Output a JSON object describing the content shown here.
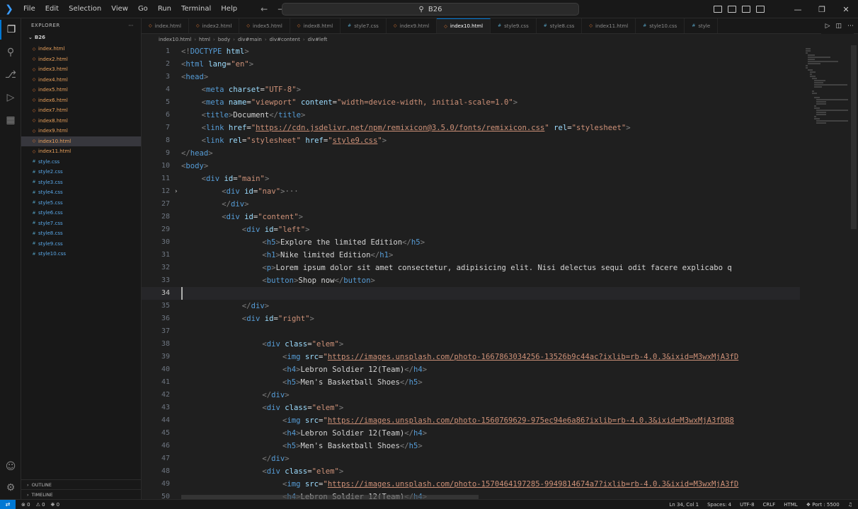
{
  "menu": [
    "File",
    "Edit",
    "Selection",
    "View",
    "Go",
    "Run",
    "Terminal",
    "Help"
  ],
  "command_center": "B26",
  "sidebar": {
    "header": "EXPLORER",
    "folder": "B26",
    "files": [
      {
        "name": "index.html",
        "type": "html"
      },
      {
        "name": "index2.html",
        "type": "html"
      },
      {
        "name": "index3.html",
        "type": "html"
      },
      {
        "name": "index4.html",
        "type": "html"
      },
      {
        "name": "index5.html",
        "type": "html"
      },
      {
        "name": "index6.html",
        "type": "html"
      },
      {
        "name": "index7.html",
        "type": "html"
      },
      {
        "name": "index8.html",
        "type": "html"
      },
      {
        "name": "index9.html",
        "type": "html"
      },
      {
        "name": "index10.html",
        "type": "html",
        "selected": true
      },
      {
        "name": "index11.html",
        "type": "html"
      },
      {
        "name": "style.css",
        "type": "css"
      },
      {
        "name": "style2.css",
        "type": "css"
      },
      {
        "name": "style3.css",
        "type": "css"
      },
      {
        "name": "style4.css",
        "type": "css"
      },
      {
        "name": "style5.css",
        "type": "css"
      },
      {
        "name": "style6.css",
        "type": "css"
      },
      {
        "name": "style7.css",
        "type": "css"
      },
      {
        "name": "style8.css",
        "type": "css"
      },
      {
        "name": "style9.css",
        "type": "css"
      },
      {
        "name": "style10.css",
        "type": "css"
      }
    ],
    "outline": "OUTLINE",
    "timeline": "TIMELINE"
  },
  "tabs": [
    {
      "label": "index.html",
      "type": "html"
    },
    {
      "label": "index2.html",
      "type": "html"
    },
    {
      "label": "index5.html",
      "type": "html"
    },
    {
      "label": "index8.html",
      "type": "html"
    },
    {
      "label": "style7.css",
      "type": "css"
    },
    {
      "label": "index9.html",
      "type": "html"
    },
    {
      "label": "index10.html",
      "type": "html",
      "active": true
    },
    {
      "label": "style9.css",
      "type": "css"
    },
    {
      "label": "style8.css",
      "type": "css"
    },
    {
      "label": "index11.html",
      "type": "html"
    },
    {
      "label": "style10.css",
      "type": "css"
    },
    {
      "label": "style",
      "type": "css"
    }
  ],
  "breadcrumb": [
    "index10.html",
    "html",
    "body",
    "div#main",
    "div#content",
    "div#left"
  ],
  "current_line": "34",
  "code_lines": [
    {
      "n": "1",
      "i": 0,
      "p": [
        [
          "t",
          "<!"
        ],
        [
          "tn",
          "DOCTYPE"
        ],
        [
          "an",
          " html"
        ],
        [
          "t",
          ">"
        ]
      ]
    },
    {
      "n": "2",
      "i": 0,
      "p": [
        [
          "t",
          "<"
        ],
        [
          "tn",
          "html"
        ],
        [
          "an",
          " lang"
        ],
        [
          "tx",
          "="
        ],
        [
          "av",
          "\"en\""
        ],
        [
          "t",
          ">"
        ]
      ]
    },
    {
      "n": "3",
      "i": 0,
      "p": [
        [
          "t",
          "<"
        ],
        [
          "tn",
          "head"
        ],
        [
          "t",
          ">"
        ]
      ]
    },
    {
      "n": "4",
      "i": 1,
      "p": [
        [
          "t",
          "<"
        ],
        [
          "tn",
          "meta"
        ],
        [
          "an",
          " charset"
        ],
        [
          "tx",
          "="
        ],
        [
          "av",
          "\"UTF-8\""
        ],
        [
          "t",
          ">"
        ]
      ]
    },
    {
      "n": "5",
      "i": 1,
      "p": [
        [
          "t",
          "<"
        ],
        [
          "tn",
          "meta"
        ],
        [
          "an",
          " name"
        ],
        [
          "tx",
          "="
        ],
        [
          "av",
          "\"viewport\""
        ],
        [
          "an",
          " content"
        ],
        [
          "tx",
          "="
        ],
        [
          "av",
          "\"width=device-width, initial-scale=1.0\""
        ],
        [
          "t",
          ">"
        ]
      ]
    },
    {
      "n": "6",
      "i": 1,
      "p": [
        [
          "t",
          "<"
        ],
        [
          "tn",
          "title"
        ],
        [
          "t",
          ">"
        ],
        [
          "tx",
          "Document"
        ],
        [
          "t",
          "</"
        ],
        [
          "tn",
          "title"
        ],
        [
          "t",
          ">"
        ]
      ]
    },
    {
      "n": "7",
      "i": 1,
      "p": [
        [
          "t",
          "<"
        ],
        [
          "tn",
          "link"
        ],
        [
          "an",
          " href"
        ],
        [
          "tx",
          "="
        ],
        [
          "av",
          "\""
        ],
        [
          "lk",
          "https://cdn.jsdelivr.net/npm/remixicon@3.5.0/fonts/remixicon.css"
        ],
        [
          "av",
          "\""
        ],
        [
          "an",
          " rel"
        ],
        [
          "tx",
          "="
        ],
        [
          "av",
          "\"stylesheet\""
        ],
        [
          "t",
          ">"
        ]
      ]
    },
    {
      "n": "8",
      "i": 1,
      "p": [
        [
          "t",
          "<"
        ],
        [
          "tn",
          "link"
        ],
        [
          "an",
          " rel"
        ],
        [
          "tx",
          "="
        ],
        [
          "av",
          "\"stylesheet\""
        ],
        [
          "an",
          " href"
        ],
        [
          "tx",
          "="
        ],
        [
          "av",
          "\""
        ],
        [
          "lk",
          "style9.css"
        ],
        [
          "av",
          "\""
        ],
        [
          "t",
          ">"
        ]
      ]
    },
    {
      "n": "9",
      "i": 0,
      "p": [
        [
          "t",
          "</"
        ],
        [
          "tn",
          "head"
        ],
        [
          "t",
          ">"
        ]
      ]
    },
    {
      "n": "10",
      "i": 0,
      "p": [
        [
          "t",
          "<"
        ],
        [
          "tn",
          "body"
        ],
        [
          "t",
          ">"
        ]
      ]
    },
    {
      "n": "11",
      "i": 1,
      "p": [
        [
          "t",
          "<"
        ],
        [
          "tn",
          "div"
        ],
        [
          "an",
          " id"
        ],
        [
          "tx",
          "="
        ],
        [
          "av",
          "\"main\""
        ],
        [
          "t",
          ">"
        ]
      ]
    },
    {
      "n": "12",
      "i": 2,
      "fold": true,
      "p": [
        [
          "t",
          "<"
        ],
        [
          "tn",
          "div"
        ],
        [
          "an",
          " id"
        ],
        [
          "tx",
          "="
        ],
        [
          "av",
          "\"nav\""
        ],
        [
          "t",
          ">"
        ],
        [
          "el",
          "···"
        ]
      ]
    },
    {
      "n": "27",
      "i": 2,
      "p": [
        [
          "t",
          "</"
        ],
        [
          "tn",
          "div"
        ],
        [
          "t",
          ">"
        ]
      ]
    },
    {
      "n": "28",
      "i": 2,
      "p": [
        [
          "t",
          "<"
        ],
        [
          "tn",
          "div"
        ],
        [
          "an",
          " id"
        ],
        [
          "tx",
          "="
        ],
        [
          "av",
          "\"content\""
        ],
        [
          "t",
          ">"
        ]
      ]
    },
    {
      "n": "29",
      "i": 3,
      "p": [
        [
          "t",
          "<"
        ],
        [
          "tn",
          "div"
        ],
        [
          "an",
          " id"
        ],
        [
          "tx",
          "="
        ],
        [
          "av",
          "\"left\""
        ],
        [
          "t",
          ">"
        ]
      ]
    },
    {
      "n": "30",
      "i": 4,
      "p": [
        [
          "t",
          "<"
        ],
        [
          "tn",
          "h5"
        ],
        [
          "t",
          ">"
        ],
        [
          "tx",
          "Explore the limited Edition"
        ],
        [
          "t",
          "</"
        ],
        [
          "tn",
          "h5"
        ],
        [
          "t",
          ">"
        ]
      ]
    },
    {
      "n": "31",
      "i": 4,
      "p": [
        [
          "t",
          "<"
        ],
        [
          "tn",
          "h1"
        ],
        [
          "t",
          ">"
        ],
        [
          "tx",
          "Nike limited Edition"
        ],
        [
          "t",
          "</"
        ],
        [
          "tn",
          "h1"
        ],
        [
          "t",
          ">"
        ]
      ]
    },
    {
      "n": "32",
      "i": 4,
      "p": [
        [
          "t",
          "<"
        ],
        [
          "tn",
          "p"
        ],
        [
          "t",
          ">"
        ],
        [
          "tx",
          "Lorem ipsum dolor sit amet consectetur, adipisicing elit. Nisi delectus sequi odit facere explicabo q"
        ]
      ]
    },
    {
      "n": "33",
      "i": 4,
      "p": [
        [
          "t",
          "<"
        ],
        [
          "tn",
          "button"
        ],
        [
          "t",
          ">"
        ],
        [
          "tx",
          "Shop now"
        ],
        [
          "t",
          "</"
        ],
        [
          "tn",
          "button"
        ],
        [
          "t",
          ">"
        ]
      ]
    },
    {
      "n": "34",
      "i": 0,
      "p": []
    },
    {
      "n": "35",
      "i": 3,
      "p": [
        [
          "t",
          "</"
        ],
        [
          "tn",
          "div"
        ],
        [
          "t",
          ">"
        ]
      ]
    },
    {
      "n": "36",
      "i": 3,
      "p": [
        [
          "t",
          "<"
        ],
        [
          "tn",
          "div"
        ],
        [
          "an",
          " id"
        ],
        [
          "tx",
          "="
        ],
        [
          "av",
          "\"right\""
        ],
        [
          "t",
          ">"
        ]
      ]
    },
    {
      "n": "37",
      "i": 0,
      "p": []
    },
    {
      "n": "38",
      "i": 4,
      "p": [
        [
          "t",
          "<"
        ],
        [
          "tn",
          "div"
        ],
        [
          "an",
          " class"
        ],
        [
          "tx",
          "="
        ],
        [
          "av",
          "\"elem\""
        ],
        [
          "t",
          ">"
        ]
      ]
    },
    {
      "n": "39",
      "i": 5,
      "p": [
        [
          "t",
          "<"
        ],
        [
          "tn",
          "img"
        ],
        [
          "an",
          " src"
        ],
        [
          "tx",
          "="
        ],
        [
          "av",
          "\""
        ],
        [
          "lk",
          "https://images.unsplash.com/photo-1667863034256-13526b9c44ac?ixlib=rb-4.0.3&ixid=M3wxMjA3fD"
        ]
      ]
    },
    {
      "n": "40",
      "i": 5,
      "p": [
        [
          "t",
          "<"
        ],
        [
          "tn",
          "h4"
        ],
        [
          "t",
          ">"
        ],
        [
          "tx",
          "Lebron Soldier 12(Team)"
        ],
        [
          "t",
          "</"
        ],
        [
          "tn",
          "h4"
        ],
        [
          "t",
          ">"
        ]
      ]
    },
    {
      "n": "41",
      "i": 5,
      "p": [
        [
          "t",
          "<"
        ],
        [
          "tn",
          "h5"
        ],
        [
          "t",
          ">"
        ],
        [
          "tx",
          "Men's Basketball Shoes"
        ],
        [
          "t",
          "</"
        ],
        [
          "tn",
          "h5"
        ],
        [
          "t",
          ">"
        ]
      ]
    },
    {
      "n": "42",
      "i": 4,
      "p": [
        [
          "t",
          "</"
        ],
        [
          "tn",
          "div"
        ],
        [
          "t",
          ">"
        ]
      ]
    },
    {
      "n": "43",
      "i": 4,
      "p": [
        [
          "t",
          "<"
        ],
        [
          "tn",
          "div"
        ],
        [
          "an",
          " class"
        ],
        [
          "tx",
          "="
        ],
        [
          "av",
          "\"elem\""
        ],
        [
          "t",
          ">"
        ]
      ]
    },
    {
      "n": "44",
      "i": 5,
      "p": [
        [
          "t",
          "<"
        ],
        [
          "tn",
          "img"
        ],
        [
          "an",
          " src"
        ],
        [
          "tx",
          "="
        ],
        [
          "av",
          "\""
        ],
        [
          "lk",
          "https://images.unsplash.com/photo-1560769629-975ec94e6a86?ixlib=rb-4.0.3&ixid=M3wxMjA3fDB8"
        ]
      ]
    },
    {
      "n": "45",
      "i": 5,
      "p": [
        [
          "t",
          "<"
        ],
        [
          "tn",
          "h4"
        ],
        [
          "t",
          ">"
        ],
        [
          "tx",
          "Lebron Soldier 12(Team)"
        ],
        [
          "t",
          "</"
        ],
        [
          "tn",
          "h4"
        ],
        [
          "t",
          ">"
        ]
      ]
    },
    {
      "n": "46",
      "i": 5,
      "p": [
        [
          "t",
          "<"
        ],
        [
          "tn",
          "h5"
        ],
        [
          "t",
          ">"
        ],
        [
          "tx",
          "Men's Basketball Shoes"
        ],
        [
          "t",
          "</"
        ],
        [
          "tn",
          "h5"
        ],
        [
          "t",
          ">"
        ]
      ]
    },
    {
      "n": "47",
      "i": 4,
      "p": [
        [
          "t",
          "</"
        ],
        [
          "tn",
          "div"
        ],
        [
          "t",
          ">"
        ]
      ]
    },
    {
      "n": "48",
      "i": 4,
      "p": [
        [
          "t",
          "<"
        ],
        [
          "tn",
          "div"
        ],
        [
          "an",
          " class"
        ],
        [
          "tx",
          "="
        ],
        [
          "av",
          "\"elem\""
        ],
        [
          "t",
          ">"
        ]
      ]
    },
    {
      "n": "49",
      "i": 5,
      "p": [
        [
          "t",
          "<"
        ],
        [
          "tn",
          "img"
        ],
        [
          "an",
          " src"
        ],
        [
          "tx",
          "="
        ],
        [
          "av",
          "\""
        ],
        [
          "lk",
          "https://images.unsplash.com/photo-1570464197285-9949814674a7?ixlib=rb-4.0.3&ixid=M3wxMjA3fD"
        ]
      ]
    },
    {
      "n": "50",
      "i": 5,
      "p": [
        [
          "t",
          "<"
        ],
        [
          "tn",
          "h4"
        ],
        [
          "t",
          ">"
        ],
        [
          "tx",
          "Lebron Soldier 12(Team)"
        ],
        [
          "t",
          "</"
        ],
        [
          "tn",
          "h4"
        ],
        [
          "t",
          ">"
        ]
      ]
    }
  ],
  "statusbar": {
    "errors": "0",
    "warnings": "0",
    "ports": "0",
    "position": "Ln 34, Col 1",
    "spaces": "Spaces: 4",
    "encoding": "UTF-8",
    "eol": "CRLF",
    "language": "HTML",
    "port": "Port : 5500"
  },
  "colors": {
    "accent": "#0078d4",
    "tag": "#569cd6",
    "attribute": "#9cdcfe",
    "string": "#ce9178"
  }
}
